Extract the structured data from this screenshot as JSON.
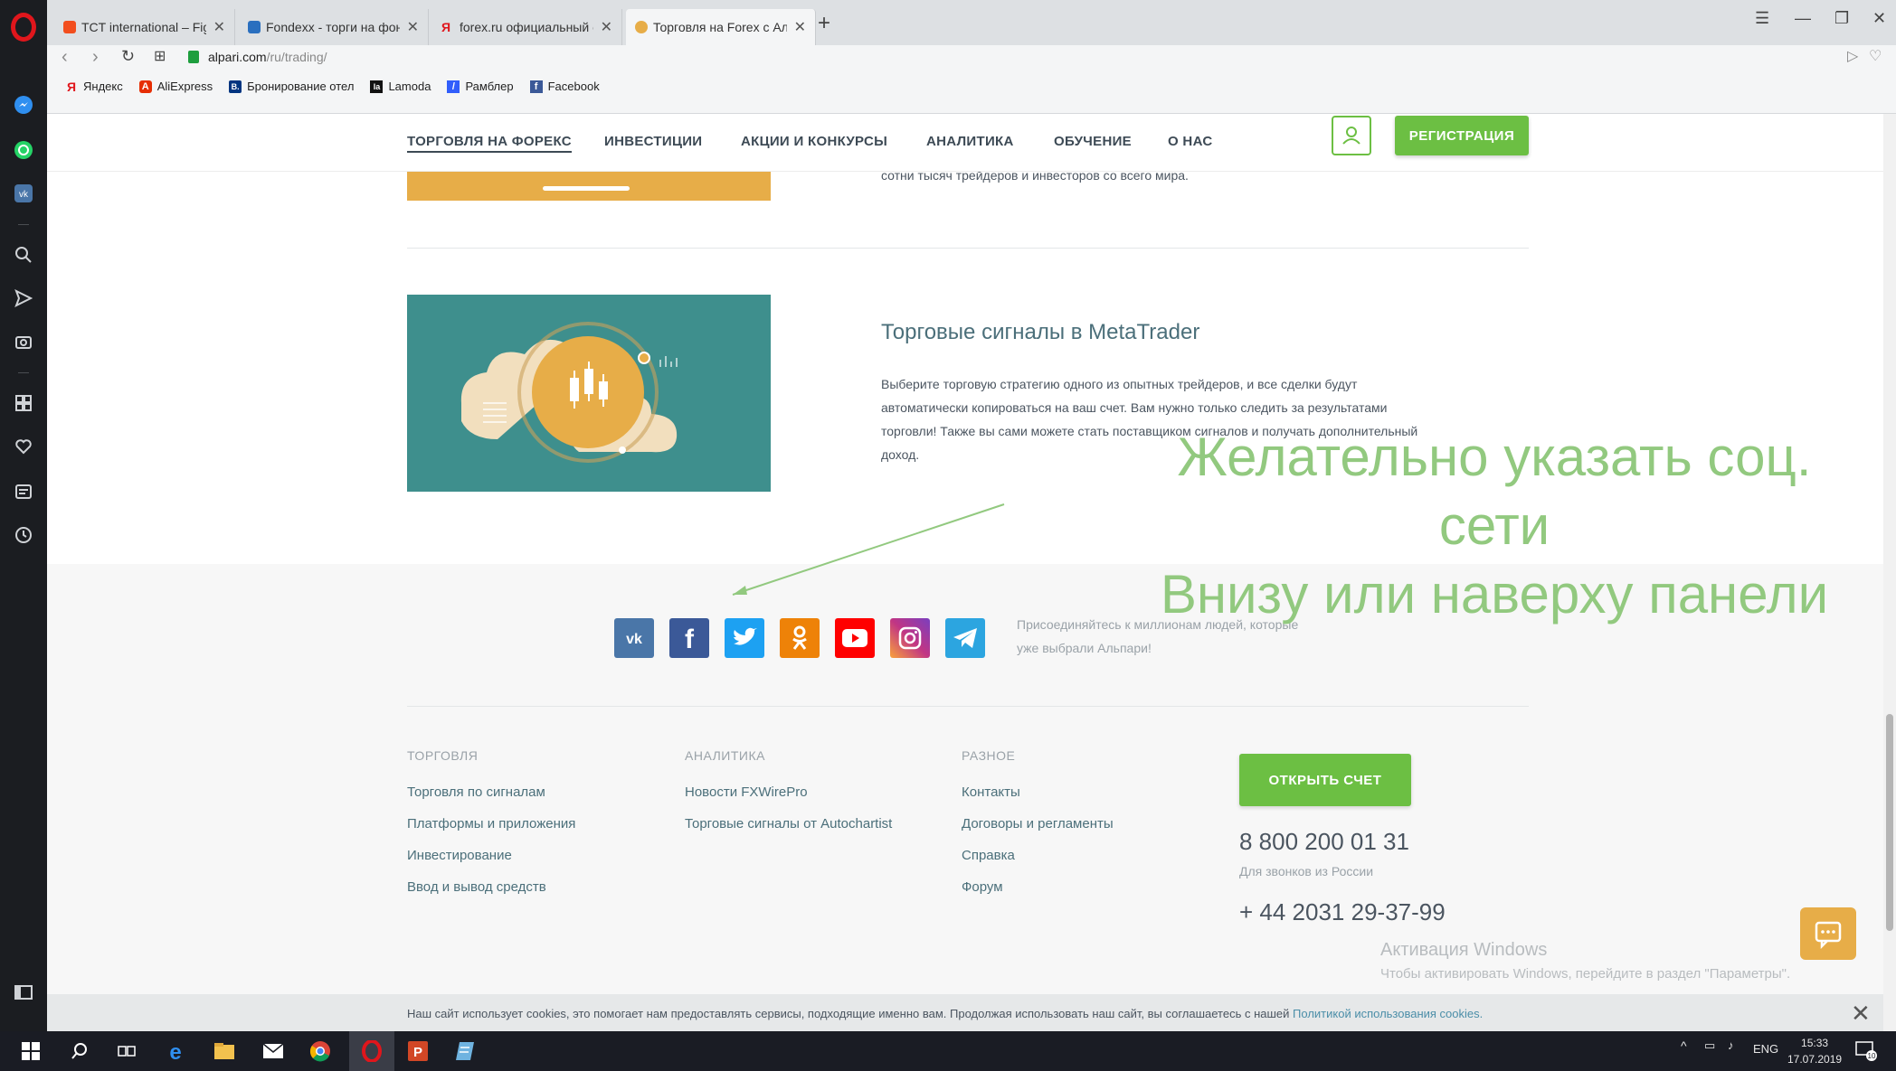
{
  "browser": {
    "tabs": [
      {
        "title": "TCT international – Figma",
        "favicon_color": "#f24e1e"
      },
      {
        "title": "Fondexx - торги на фондо",
        "favicon_color": "#2a6fbf"
      },
      {
        "title": "forex.ru официальный са",
        "favicon_color": "#e0161c"
      },
      {
        "title": "Торговля на Forex с Альп",
        "favicon_color": "#e7ad48",
        "active": true
      }
    ],
    "url_host": "alpari.com",
    "url_path": "/ru/trading/",
    "bookmarks": [
      {
        "label": "Яндекс",
        "icon": "Я",
        "color": "#e0161c"
      },
      {
        "label": "AliExpress",
        "icon": "A",
        "color": "#e62e04"
      },
      {
        "label": "Бронирование отел",
        "icon": "B.",
        "color": "#003580"
      },
      {
        "label": "Lamoda",
        "icon": "la",
        "color": "#111111"
      },
      {
        "label": "Рамблер",
        "icon": "/",
        "color": "#315efb"
      },
      {
        "label": "Facebook",
        "icon": "f",
        "color": "#3b5998"
      }
    ]
  },
  "site_nav": {
    "items": [
      "ТОРГОВЛЯ НА ФОРЕКС",
      "ИНВЕСТИЦИИ",
      "АКЦИИ И КОНКУРСЫ",
      "АНАЛИТИКА",
      "ОБУЧЕНИЕ",
      "О НАС"
    ],
    "register_label": "РЕГИСТРАЦИЯ"
  },
  "content": {
    "top_text": "сотни тысяч трейдеров и инвесторов со всего мира.",
    "signals_title": "Торговые сигналы в MetaTrader",
    "signals_desc": "Выберите торговую стратегию одного из опытных трейдеров, и все сделки будут автоматически копироваться на ваш счет. Вам нужно только следить за результатами торговли! Также вы сами можете стать поставщиком сигналов и получать дополнительный доход."
  },
  "annotation": {
    "line1": "Желательно указать соц.",
    "line2": "сети",
    "line3": "Внизу или наверху панели",
    "color": "#92c97f"
  },
  "footer": {
    "social": [
      {
        "name": "vk",
        "color": "#4a76a8"
      },
      {
        "name": "facebook",
        "color": "#3b5998"
      },
      {
        "name": "twitter",
        "color": "#1da1f2"
      },
      {
        "name": "odnoklassniki",
        "color": "#ee8208"
      },
      {
        "name": "youtube",
        "color": "#ff0000"
      },
      {
        "name": "instagram",
        "color": "#c13584"
      },
      {
        "name": "telegram",
        "color": "#2ca5e0"
      }
    ],
    "join_text": "Присоединяйтесь к миллионам людей, которые уже выбрали Альпари!",
    "columns": [
      {
        "title": "ТОРГОВЛЯ",
        "links": [
          "Торговля по сигналам",
          "Платформы и приложения",
          "Инвестирование",
          "Ввод и вывод средств"
        ]
      },
      {
        "title": "АНАЛИТИКА",
        "links": [
          "Новости FXWirePro",
          "Торговые сигналы от Autochartist"
        ]
      },
      {
        "title": "РАЗНОЕ",
        "links": [
          "Контакты",
          "Договоры и регламенты",
          "Справка",
          "Форум"
        ]
      }
    ],
    "open_account_label": "ОТКРЫТЬ СЧЕТ",
    "phone_ru": "8 800 200 01 31",
    "phone_ru_note": "Для звонков из России",
    "phone_intl": "+ 44 2031 29-37-99"
  },
  "cookie": {
    "text": "Наш сайт использует cookies, это помогает нам предоставлять сервисы, подходящие именно вам. Продолжая использовать наш сайт, вы соглашаетесь с нашей ",
    "link": "Политикой использования cookies."
  },
  "windows": {
    "activation_title": "Активация Windows",
    "activation_sub": "Чтобы активировать Windows, перейдите в раздел \"Параметры\".",
    "lang": "ENG",
    "time": "15:33",
    "date": "17.07.2019",
    "notif_count": "10"
  },
  "accent": "#6cbf43"
}
